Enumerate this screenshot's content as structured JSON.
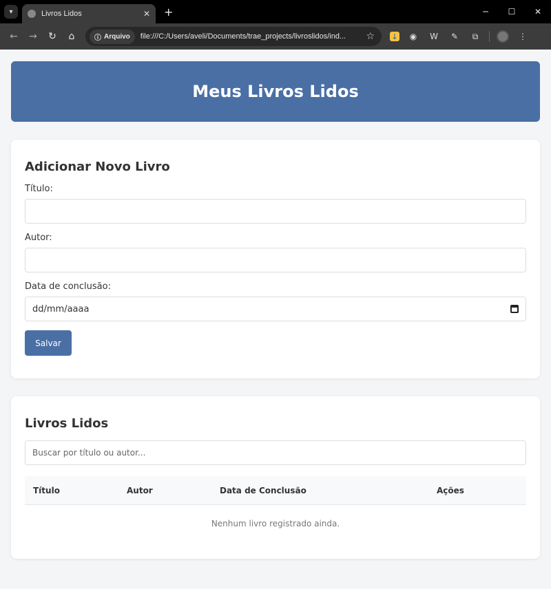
{
  "browser": {
    "tab_title": "Livros Lidos",
    "site_chip": "Arquivo",
    "url": "file:///C:/Users/aveli/Documents/trae_projects/livroslidos/ind..."
  },
  "header": {
    "title": "Meus Livros Lidos"
  },
  "form": {
    "title": "Adicionar Novo Livro",
    "title_label": "Título:",
    "author_label": "Autor:",
    "date_label": "Data de conclusão:",
    "date_placeholder": "dd/mm/aaaa",
    "save_label": "Salvar"
  },
  "list": {
    "title": "Livros Lidos",
    "search_placeholder": "Buscar por título ou autor...",
    "columns": [
      "Título",
      "Autor",
      "Data de Conclusão",
      "Ações"
    ],
    "empty_message": "Nenhum livro registrado ainda."
  },
  "colors": {
    "primary": "#4a6fa5",
    "background": "#f4f5f7"
  }
}
